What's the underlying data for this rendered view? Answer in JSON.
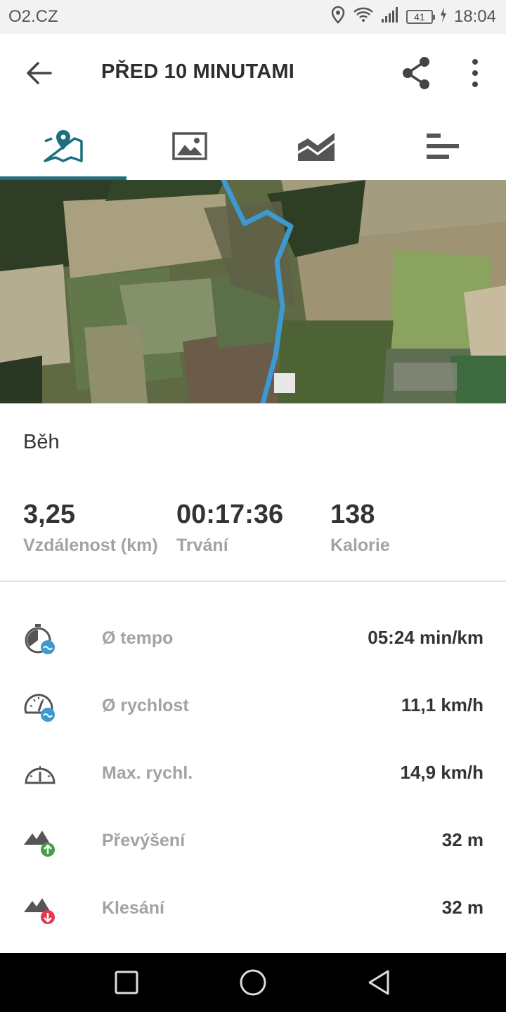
{
  "status_bar": {
    "carrier": "O2.CZ",
    "battery": "41",
    "time": "18:04",
    "icons": [
      "location-icon",
      "wifi-icon",
      "signal-icon",
      "battery-icon",
      "charging-icon"
    ]
  },
  "app_bar": {
    "title": "PŘED 10 MINUTAMI",
    "icons": [
      "back-arrow-icon",
      "share-icon",
      "more-vert-icon"
    ]
  },
  "tabs": [
    {
      "name": "map-tab",
      "icon": "map-pin-icon",
      "active": true
    },
    {
      "name": "photos-tab",
      "icon": "image-icon",
      "active": false
    },
    {
      "name": "chart-tab",
      "icon": "area-chart-icon",
      "active": false
    },
    {
      "name": "details-tab",
      "icon": "bars-icon",
      "active": false
    }
  ],
  "activity": {
    "type": "Běh"
  },
  "summary": {
    "distance": {
      "value": "3,25",
      "label": "Vzdálenost (km)"
    },
    "duration": {
      "value": "00:17:36",
      "label": "Trvání"
    },
    "calories": {
      "value": "138",
      "label": "Kalorie"
    }
  },
  "stats": [
    {
      "name": "Ø tempo",
      "value": "05:24 min/km",
      "icon": "stopwatch-avg-icon"
    },
    {
      "name": "Ø rychlost",
      "value": "11,1 km/h",
      "icon": "speedometer-avg-icon"
    },
    {
      "name": "Max. rychl.",
      "value": "14,9 km/h",
      "icon": "speedometer-icon"
    },
    {
      "name": "Převýšení",
      "value": "32 m",
      "icon": "elevation-up-icon"
    },
    {
      "name": "Klesání",
      "value": "32 m",
      "icon": "elevation-down-icon"
    }
  ],
  "colors": {
    "accent": "#1d6f80",
    "route": "#3d9ad1",
    "up_badge": "#43a047",
    "down_badge": "#e53950",
    "avg_badge": "#3d9ad1"
  }
}
